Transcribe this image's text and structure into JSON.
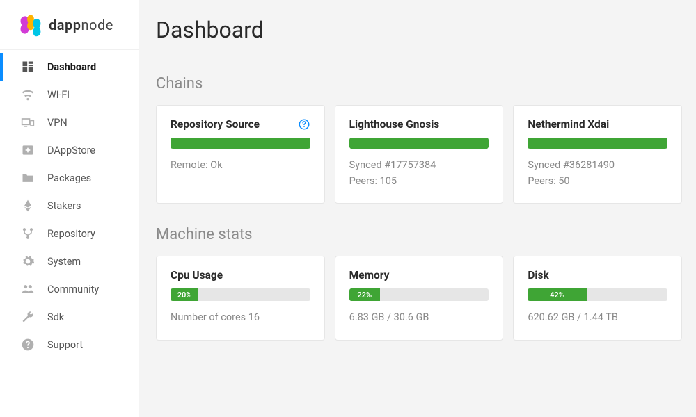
{
  "brand": {
    "name_bold": "dapp",
    "name_light": "node"
  },
  "sidebar": {
    "items": [
      {
        "label": "Dashboard"
      },
      {
        "label": "Wi-Fi"
      },
      {
        "label": "VPN"
      },
      {
        "label": "DAppStore"
      },
      {
        "label": "Packages"
      },
      {
        "label": "Stakers"
      },
      {
        "label": "Repository"
      },
      {
        "label": "System"
      },
      {
        "label": "Community"
      },
      {
        "label": "Sdk"
      },
      {
        "label": "Support"
      }
    ]
  },
  "page": {
    "title": "Dashboard"
  },
  "sections": {
    "chains": {
      "title": "Chains",
      "cards": [
        {
          "title": "Repository Source",
          "progress_pct": 100,
          "line1": "Remote: Ok",
          "line2": "",
          "has_help": true
        },
        {
          "title": "Lighthouse Gnosis",
          "progress_pct": 100,
          "line1": "Synced #17757384",
          "line2": "Peers: 105"
        },
        {
          "title": "Nethermind Xdai",
          "progress_pct": 100,
          "line1": "Synced #36281490",
          "line2": "Peers: 50"
        }
      ]
    },
    "stats": {
      "title": "Machine stats",
      "cards": [
        {
          "title": "Cpu Usage",
          "pct": 20,
          "pct_label": "20%",
          "sub": "Number of cores 16"
        },
        {
          "title": "Memory",
          "pct": 22,
          "pct_label": "22%",
          "sub": "6.83 GB / 30.6 GB"
        },
        {
          "title": "Disk",
          "pct": 42,
          "pct_label": "42%",
          "sub": "620.62 GB / 1.44 TB"
        }
      ]
    }
  },
  "colors": {
    "accent": "#0b8dff",
    "bar": "#3fa535"
  }
}
